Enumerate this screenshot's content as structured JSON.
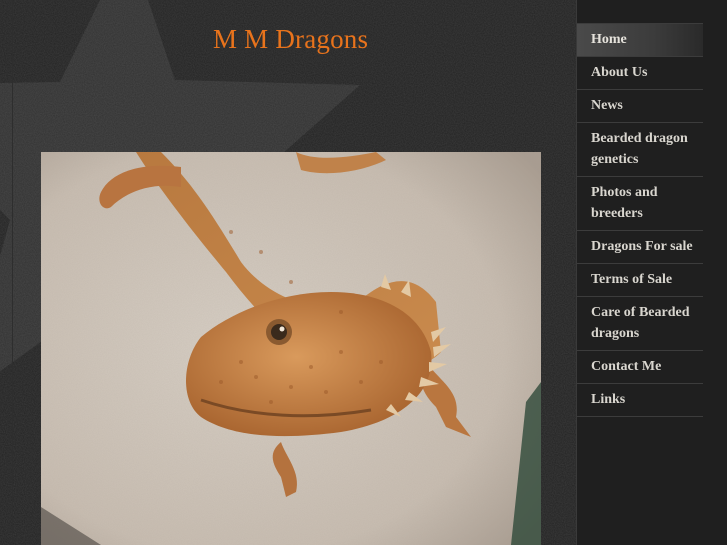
{
  "site": {
    "title": "M M Dragons"
  },
  "nav": {
    "items": [
      {
        "label": "Home",
        "active": true
      },
      {
        "label": "About Us"
      },
      {
        "label": "News"
      },
      {
        "label": "Bearded dragon genetics"
      },
      {
        "label": "Photos and breeders"
      },
      {
        "label": "Dragons For sale"
      },
      {
        "label": "Terms of Sale"
      },
      {
        "label": "Care of Bearded dragons"
      },
      {
        "label": "Contact Me"
      },
      {
        "label": "Links"
      }
    ]
  },
  "photo": {
    "icon": "bearded-dragon-photo"
  },
  "colors": {
    "title": "#e8731c",
    "background": "#222222",
    "nav_text": "#d9d6cf"
  }
}
